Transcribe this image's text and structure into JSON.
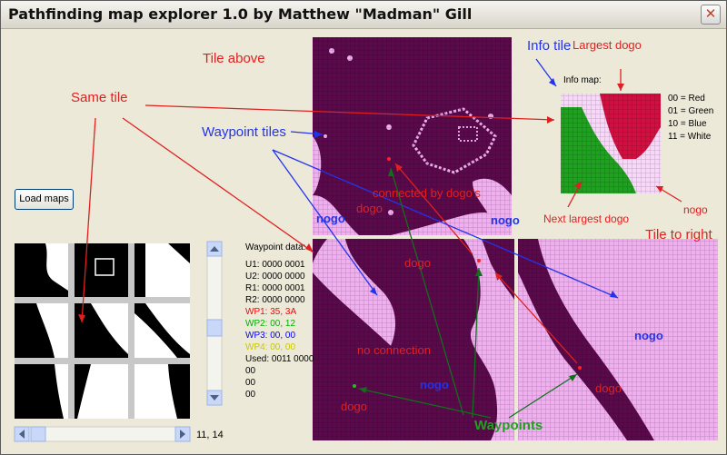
{
  "window": {
    "title": "Pathfinding map explorer 1.0 by Matthew \"Madman\" Gill",
    "close_glyph": "✕"
  },
  "load_button": {
    "label": "Load maps"
  },
  "coords": "11, 14",
  "info_map": {
    "label": "Info map:",
    "legend": [
      "00 = Red",
      "01 = Green",
      "10 = Blue",
      "11 = White"
    ]
  },
  "waypoint": {
    "title": "Waypoint data:",
    "lines": [
      {
        "text": "U1: 0000 0001",
        "color": "#000000"
      },
      {
        "text": "U2: 0000 0000",
        "color": "#000000"
      },
      {
        "text": "R1: 0000 0001",
        "color": "#000000"
      },
      {
        "text": "R2: 0000 0000",
        "color": "#000000"
      },
      {
        "text": "WP1: 35, 3A",
        "color": "#ff0000"
      },
      {
        "text": "WP2: 00, 12",
        "color": "#00b000"
      },
      {
        "text": "WP3: 00, 00",
        "color": "#0000ff"
      },
      {
        "text": "WP4: 00, 00",
        "color": "#c8c800"
      },
      {
        "text": "Used: 0011 0000",
        "color": "#000000"
      },
      {
        "text": "00",
        "color": "#000000"
      },
      {
        "text": "00",
        "color": "#000000"
      },
      {
        "text": "00",
        "color": "#000000"
      }
    ]
  },
  "annotations": {
    "tile_above": "Tile above",
    "info_tile": "Info tile",
    "largest_dogo": "Largest dogo",
    "same_tile": "Same tile",
    "waypoint_tiles": "Waypoint tiles",
    "connected": "connected by dogo's",
    "dogo": "dogo",
    "nogo": "nogo",
    "next_largest": "Next largest dogo",
    "tile_to_right": "Tile to right",
    "no_connection": "no connection",
    "waypoints": "Waypoints"
  },
  "colors": {
    "dark": "#5a0a4a",
    "light": "#f0b0f0",
    "info_red": "#d01040",
    "info_green": "#20a020",
    "info_white": "#f8d8f8",
    "arrow_red": "#e02020",
    "arrow_blue": "#2233ee",
    "arrow_green": "#10701a"
  }
}
